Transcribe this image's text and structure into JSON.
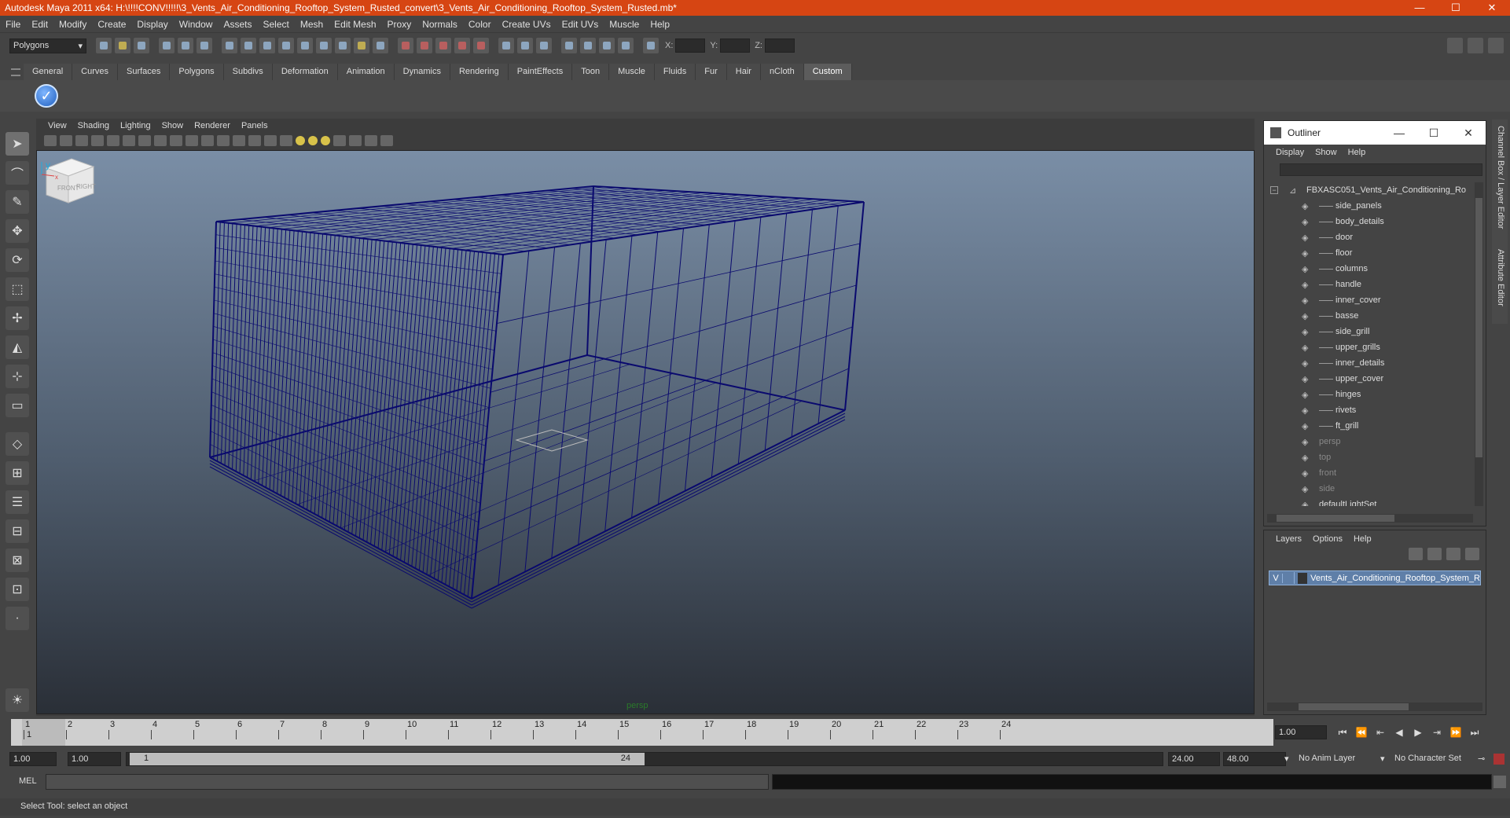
{
  "window": {
    "title": "Autodesk Maya 2011 x64: H:\\!!!!CONV!!!!!\\3_Vents_Air_Conditioning_Rooftop_System_Rusted_convert\\3_Vents_Air_Conditioning_Rooftop_System_Rusted.mb*",
    "minimize": "—",
    "maximize": "☐",
    "close": "✕"
  },
  "menu": [
    "File",
    "Edit",
    "Modify",
    "Create",
    "Display",
    "Window",
    "Assets",
    "Select",
    "Mesh",
    "Edit Mesh",
    "Proxy",
    "Normals",
    "Color",
    "Create UVs",
    "Edit UVs",
    "Muscle",
    "Help"
  ],
  "statusline": {
    "mode": "Polygons",
    "x_label": "X:",
    "y_label": "Y:",
    "z_label": "Z:"
  },
  "shelf": {
    "tabs": [
      "General",
      "Curves",
      "Surfaces",
      "Polygons",
      "Subdivs",
      "Deformation",
      "Animation",
      "Dynamics",
      "Rendering",
      "PaintEffects",
      "Toon",
      "Muscle",
      "Fluids",
      "Fur",
      "Hair",
      "nCloth",
      "Custom"
    ],
    "active_tab": "Custom",
    "icon": "checkmark-icon"
  },
  "viewport": {
    "menu": [
      "View",
      "Shading",
      "Lighting",
      "Show",
      "Renderer",
      "Panels"
    ],
    "camera_label": "persp",
    "viewcube_front": "FRONT",
    "viewcube_right": "RIGHT",
    "axis_y": "y",
    "axis_x": "x",
    "wire_color": "#0a0a6e"
  },
  "side_tabs": [
    "Channel Box / Layer Editor",
    "Attribute Editor"
  ],
  "outliner": {
    "title": "Outliner",
    "menu": [
      "Display",
      "Show",
      "Help"
    ],
    "root": "FBXASC051_Vents_Air_Conditioning_Ro",
    "children": [
      "side_panels",
      "body_details",
      "door",
      "floor",
      "columns",
      "handle",
      "inner_cover",
      "basse",
      "side_grill",
      "upper_grills",
      "inner_details",
      "upper_cover",
      "hinges",
      "rivets",
      "ft_grill"
    ],
    "cameras": [
      "persp",
      "top",
      "front",
      "side"
    ],
    "sets": [
      "defaultLightSet"
    ]
  },
  "layers": {
    "menu": [
      "Layers",
      "Options",
      "Help"
    ],
    "layer_visible": "V",
    "layer_name": "Vents_Air_Conditioning_Rooftop_System_R"
  },
  "timeline": {
    "ticks": [
      "1",
      "2",
      "3",
      "4",
      "5",
      "6",
      "7",
      "8",
      "9",
      "10",
      "11",
      "12",
      "13",
      "14",
      "15",
      "16",
      "17",
      "18",
      "19",
      "20",
      "21",
      "22",
      "23",
      "24"
    ],
    "current_frame": "1",
    "current_field": "1.00"
  },
  "range": {
    "start": "1.00",
    "start2": "1.00",
    "handle_start": "1",
    "handle_end": "24",
    "end": "24.00",
    "end2": "48.00",
    "anim_layer": "No Anim Layer",
    "character_set": "No Character Set"
  },
  "command": {
    "label": "MEL"
  },
  "help": {
    "text": "Select Tool: select an object"
  }
}
